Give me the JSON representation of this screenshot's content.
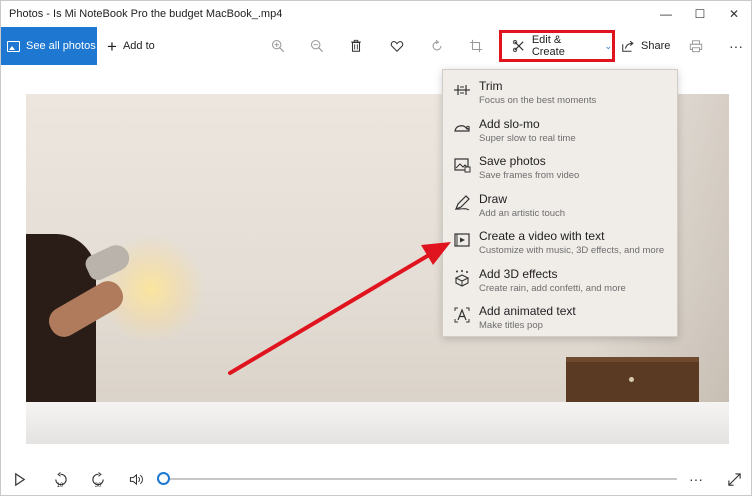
{
  "window": {
    "title": "Photos - Is Mi NoteBook Pro the budget MacBook_.mp4",
    "controls": {
      "minimize": "—",
      "maximize": "☐",
      "close": "✕"
    }
  },
  "toolbar": {
    "see_all_photos": "See all photos",
    "add_to": "Add to",
    "edit_create": "Edit & Create",
    "share": "Share",
    "more": "···",
    "icons": [
      "zoom-in-icon",
      "zoom-out-icon",
      "delete-icon",
      "favorite-icon",
      "rotate-icon",
      "crop-icon",
      "print-icon"
    ]
  },
  "menu": {
    "items": [
      {
        "label": "Trim",
        "desc": "Focus on the best moments",
        "icon": "trim-icon"
      },
      {
        "label": "Add slo-mo",
        "desc": "Super slow to real time",
        "icon": "slo-mo-icon"
      },
      {
        "label": "Save photos",
        "desc": "Save frames from video",
        "icon": "save-photos-icon"
      },
      {
        "label": "Draw",
        "desc": "Add an artistic touch",
        "icon": "draw-icon"
      },
      {
        "label": "Create a video with text",
        "desc": "Customize with music, 3D effects, and more",
        "icon": "video-text-icon"
      },
      {
        "label": "Add 3D effects",
        "desc": "Create rain, add confetti, and more",
        "icon": "3d-effects-icon"
      },
      {
        "label": "Add animated text",
        "desc": "Make titles pop",
        "icon": "animated-text-icon"
      }
    ]
  },
  "playback": {
    "skip_back": "10",
    "skip_forward": "30",
    "progress": 0.0,
    "more": "···"
  },
  "colors": {
    "accent": "#1e78d2",
    "highlight": "#e0141e"
  }
}
